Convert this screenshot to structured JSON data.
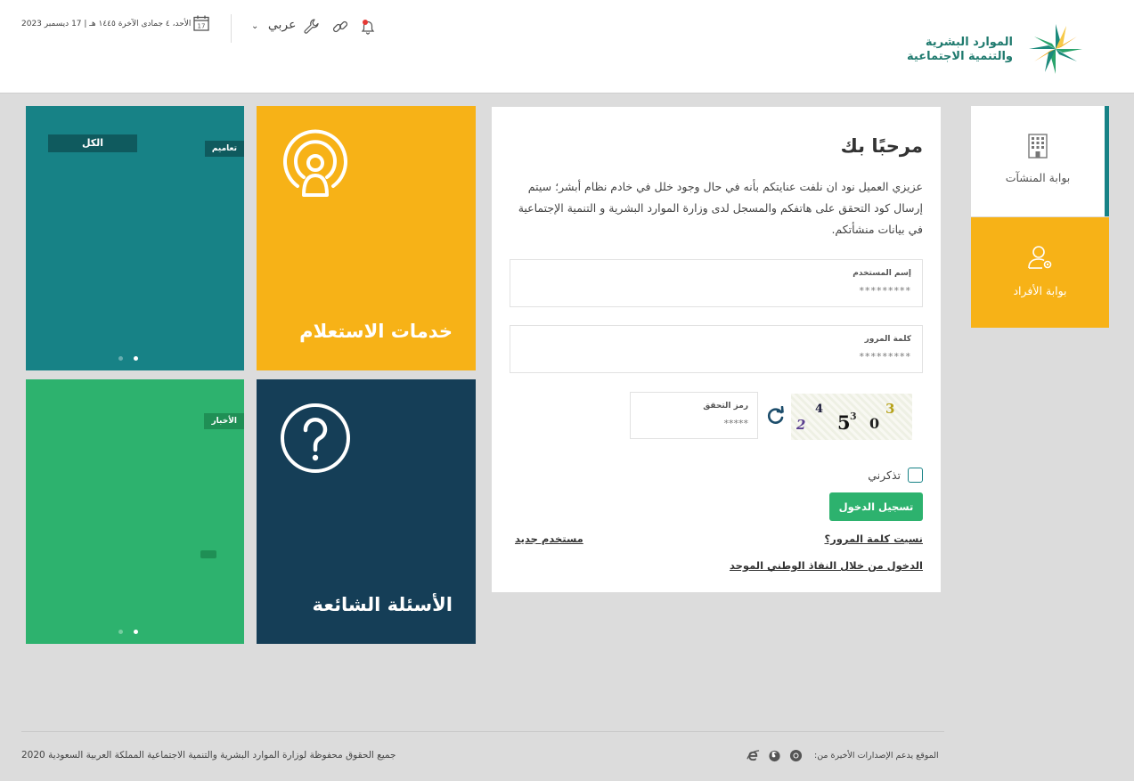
{
  "header": {
    "logo_line1": "الموارد البشرية",
    "logo_line2": "والتنمية الاجتماعية",
    "date_text": "الأحد، ٤ جمادى الآخرة ١٤٤٥ هـ | 17 ديسمبر 2023",
    "calendar_day": "17",
    "language_label": "عربي"
  },
  "tiles": {
    "news": {
      "all_label": "الكل",
      "tag_label": "تعاميم"
    },
    "inquiry": {
      "title": "خدمات الاستعلام"
    },
    "news2": {
      "tag_label": "الأخبار"
    },
    "faq": {
      "title": "الأسئلة الشائعة"
    }
  },
  "login": {
    "heading": "مرحبًا بك",
    "intro": "عزيزي العميل نود ان نلفت عنايتكم بأنه في حال وجود خلل في خادم نظام أبشر؛ سيتم إرسال كود التحقق على هاتفكم والمسجل لدى وزارة الموارد البشرية و التنمية الإجتماعية في بيانات منشأتكم.",
    "username_label": "إسم المستخدم",
    "username_value": "*********",
    "password_label": "كلمة المرور",
    "password_value": "*********",
    "captcha_label": "رمز التحقق",
    "captcha_placeholder": "*****",
    "captcha_chars": [
      "2",
      "4",
      "5",
      "3",
      "0",
      "3"
    ],
    "remember_label": "تذكرني",
    "login_button": "تسجيل الدخول",
    "forgot_password": "نسيت كلمة المرور؟",
    "new_user": "مستخدم جديد",
    "nafath_login": "الدخول من خلال النفاذ الوطني الموحد"
  },
  "portals": {
    "establishments": "بوابة المنشآت",
    "individuals": "بوابة الأفراد"
  },
  "footer": {
    "copyright": "جميع الحقوق محفوظة لوزارة الموارد البشرية والتنمية الاجتماعية المملكة العربية السعودية 2020",
    "browsers_text": "الموقع يدعم الإصدارات الأخيرة من:"
  },
  "colors": {
    "teal": "#178286",
    "yellow": "#f7b217",
    "green": "#2db26e",
    "navy": "#153e57",
    "page_bg": "#dcdcdc"
  },
  "icons": [
    "calendar-icon",
    "bell-icon",
    "link-icon",
    "wrench-icon",
    "chevron-down-icon",
    "podcast-icon",
    "question-circle-icon",
    "refresh-icon",
    "building-icon",
    "user-gear-icon",
    "ie-icon",
    "firefox-icon",
    "chrome-icon"
  ]
}
